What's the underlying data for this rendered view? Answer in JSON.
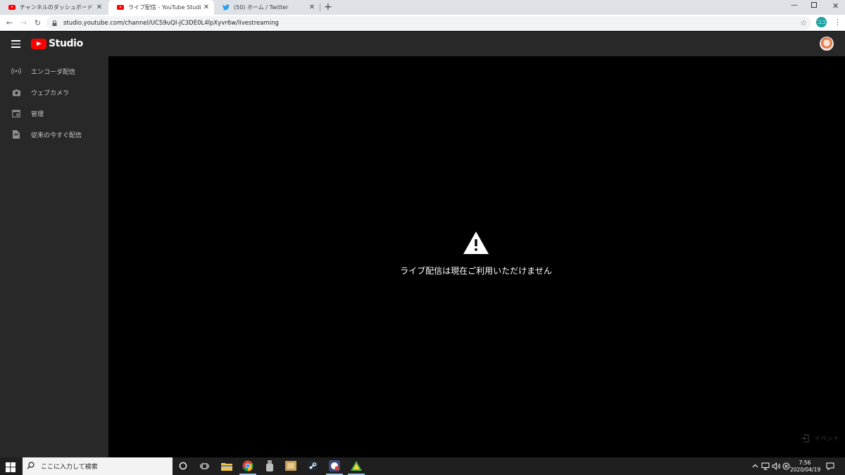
{
  "browser": {
    "tabs": [
      {
        "title": "チャンネルのダッシュボード - YouTube",
        "active": false,
        "favicon": "youtube-icon"
      },
      {
        "title": "ライブ配信 - YouTube Studio",
        "active": true,
        "favicon": "youtube-icon"
      },
      {
        "title": "(50) ホーム / Twitter",
        "active": false,
        "favicon": "twitter-icon"
      }
    ],
    "url": "studio.youtube.com/channel/UCS9uQI-jC3DE0L4lpXyvr6w/livestreaming",
    "profile_badge": "ココ"
  },
  "studio": {
    "logo_text": "Studio",
    "sidebar": [
      {
        "label": "エンコーダ配信",
        "icon": "broadcast-icon"
      },
      {
        "label": "ウェブカメラ",
        "icon": "camera-icon"
      },
      {
        "label": "管理",
        "icon": "calendar-icon"
      },
      {
        "label": "従来の今すぐ配信",
        "icon": "classic-live-icon"
      }
    ],
    "main": {
      "error_message": "ライブ配信は現在ご利用いただけません",
      "events_label": "イベント"
    }
  },
  "taskbar": {
    "search_placeholder": "ここに入力して検索",
    "time": "7:56",
    "date": "2020/04/19"
  },
  "colors": {
    "youtube_red": "#ff0000",
    "twitter_blue": "#1da1f2",
    "studio_header": "#282828",
    "main_bg": "#000000"
  }
}
